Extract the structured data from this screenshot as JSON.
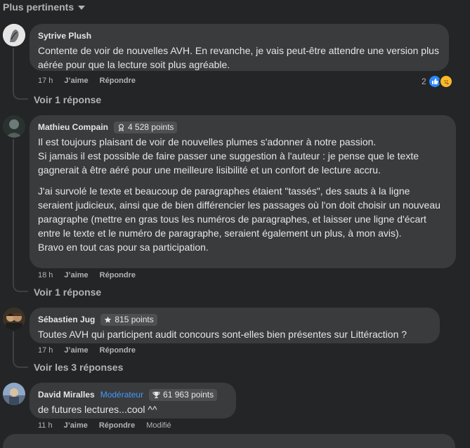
{
  "sort": {
    "label": "Plus pertinents"
  },
  "actions": {
    "like": "J’aime",
    "reply": "Répondre",
    "modified": "Modifié"
  },
  "comments": [
    {
      "author": "Sytrive Plush",
      "text": "Contente de voir de nouvelles AVH. En revanche, je vais peut-être attendre une version plus aérée pour que la lecture soit plus agréable.",
      "time": "17 h",
      "reaction_count": "2",
      "view_replies": "Voir 1 réponse"
    },
    {
      "author": "Mathieu Compain",
      "badge": "4 528 points",
      "paragraphs": [
        "Il est toujours plaisant de voir de nouvelles plumes s'adonner à notre passion.",
        "Si jamais il est possible de faire passer une suggestion à l'auteur : je pense que le texte gagnerait à être aéré pour une meilleure lisibilité et un confort de lecture accru.",
        "J'ai survolé le texte et beaucoup de paragraphes étaient \"tassés\", des sauts à la ligne seraient judicieux, ainsi que de bien différencier les passages où l'on doit choisir un nouveau paragraphe (mettre en gras tous les numéros de paragraphes, et laisser une ligne d'écart entre le texte et le numéro de paragraphe, seraient également un plus, à mon avis).",
        "Bravo en tout cas pour sa participation."
      ],
      "time": "18 h",
      "view_replies": "Voir 1 réponse"
    },
    {
      "author": "Sébastien Jug",
      "badge": "815 points",
      "text": "Toutes AVH qui participent audit concours sont-elles bien présentes sur Littéraction ?",
      "time": "17 h",
      "view_replies": "Voir les 3 réponses"
    },
    {
      "author": "David Miralles",
      "role": "Modérateur",
      "badge": "61 963 points",
      "text": "de futures lectures...cool ^^",
      "time": "11 h"
    }
  ],
  "colors": {
    "background": "#242526",
    "bubble": "#3a3b3c",
    "link_blue": "#4599ff",
    "secondary_text": "#b0b3b8"
  }
}
